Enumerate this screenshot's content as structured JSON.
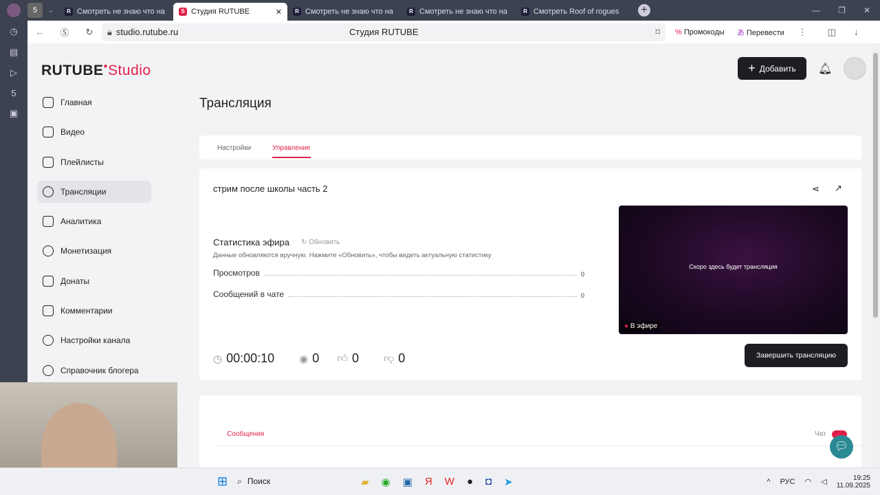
{
  "browser": {
    "tabs": [
      {
        "label": "Смотреть не знаю что на",
        "active": false
      },
      {
        "label": "Студия RUTUBE",
        "active": true
      },
      {
        "label": "Смотреть не знаю что на",
        "active": false
      },
      {
        "label": "Смотреть не знаю что на",
        "active": false
      },
      {
        "label": "Смотреть Roof of rogues",
        "active": false
      }
    ],
    "url": "studio.rutube.ru",
    "page_title": "Студия RUTUBE",
    "promo": "Промокоды",
    "translate": "Перевести"
  },
  "logo": {
    "main": "RUTUBE",
    "sub": "Studio"
  },
  "header": {
    "add_label": "Добавить"
  },
  "nav": [
    {
      "label": "Главная"
    },
    {
      "label": "Видео"
    },
    {
      "label": "Плейлисты"
    },
    {
      "label": "Трансляции",
      "selected": true
    },
    {
      "label": "Аналитика"
    },
    {
      "label": "Монетизация"
    },
    {
      "label": "Донаты"
    },
    {
      "label": "Комментарии"
    },
    {
      "label": "Настройки канала"
    },
    {
      "label": "Справочник блогера"
    }
  ],
  "main": {
    "title": "Трансляция",
    "tabs": [
      {
        "label": "Настройки"
      },
      {
        "label": "Управление",
        "active": true
      }
    ],
    "stream_name": "стрим после школы часть 2",
    "stats_title": "Статистика эфира",
    "refresh": "Обновить",
    "stats_note": "Данные обновляются вручную. Нажмите «Обновить», чтобы видеть актуальную статистику",
    "stats": [
      {
        "label": "Просмотров",
        "value": "0"
      },
      {
        "label": "Сообщений в чате",
        "value": "0"
      }
    ],
    "timer": "00:00:10",
    "viewers": "0",
    "likes": "0",
    "dislikes": "0",
    "preview_text": "Скоро здесь будет трансляция",
    "live_badge": "В эфире",
    "end_button": "Завершить трансляцию",
    "messages_tab": "Сообщения",
    "chat_label": "Чат"
  },
  "taskbar": {
    "search": "Поиск",
    "lang": "РУС",
    "time": "19:25",
    "date": "11.09.2025"
  },
  "colors": {
    "accent": "#e0204a",
    "dark": "#1d1d22"
  }
}
